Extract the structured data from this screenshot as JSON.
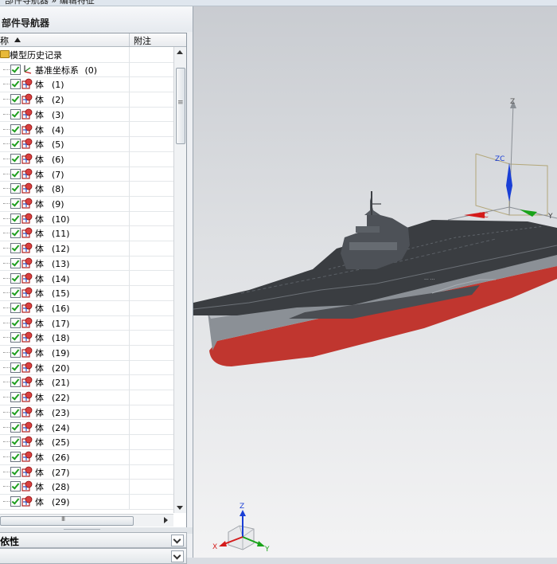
{
  "window": {
    "title_fragment": "部件导航器 » 编辑特征"
  },
  "navigator": {
    "title": "部件导航器",
    "columns": {
      "name": "称",
      "notes": "附注"
    },
    "root": {
      "label": "模型历史记录"
    },
    "csys": {
      "label": "基准坐标系",
      "index": "(0)"
    },
    "bodies": [
      {
        "label": "体",
        "index": "(1)"
      },
      {
        "label": "体",
        "index": "(2)"
      },
      {
        "label": "体",
        "index": "(3)"
      },
      {
        "label": "体",
        "index": "(4)"
      },
      {
        "label": "体",
        "index": "(5)"
      },
      {
        "label": "体",
        "index": "(6)"
      },
      {
        "label": "体",
        "index": "(7)"
      },
      {
        "label": "体",
        "index": "(8)"
      },
      {
        "label": "体",
        "index": "(9)"
      },
      {
        "label": "体",
        "index": "(10)"
      },
      {
        "label": "体",
        "index": "(11)"
      },
      {
        "label": "体",
        "index": "(12)"
      },
      {
        "label": "体",
        "index": "(13)"
      },
      {
        "label": "体",
        "index": "(14)"
      },
      {
        "label": "体",
        "index": "(15)"
      },
      {
        "label": "体",
        "index": "(16)"
      },
      {
        "label": "体",
        "index": "(17)"
      },
      {
        "label": "体",
        "index": "(18)"
      },
      {
        "label": "体",
        "index": "(19)"
      },
      {
        "label": "体",
        "index": "(20)"
      },
      {
        "label": "体",
        "index": "(21)"
      },
      {
        "label": "体",
        "index": "(22)"
      },
      {
        "label": "体",
        "index": "(23)"
      },
      {
        "label": "体",
        "index": "(24)"
      },
      {
        "label": "体",
        "index": "(25)"
      },
      {
        "label": "体",
        "index": "(26)"
      },
      {
        "label": "体",
        "index": "(27)"
      },
      {
        "label": "体",
        "index": "(28)"
      },
      {
        "label": "体",
        "index": "(29)"
      }
    ],
    "hscroll_glyph": "III"
  },
  "panels": [
    {
      "label": "依性"
    },
    {
      "label": ""
    }
  ],
  "viewport": {
    "model_axes": {
      "z": "Z",
      "zc": "ZC",
      "xc": "XC",
      "y": "Y"
    },
    "view_triad": {
      "z": "Z",
      "x": "X",
      "y": "Y"
    },
    "colors": {
      "hull_red": "#c0362f",
      "hull_gray": "#8b9096",
      "deck": "#3a3d41",
      "axis_blue": "#1a3fd6",
      "axis_red": "#d41b1b",
      "axis_green": "#19a319"
    }
  }
}
